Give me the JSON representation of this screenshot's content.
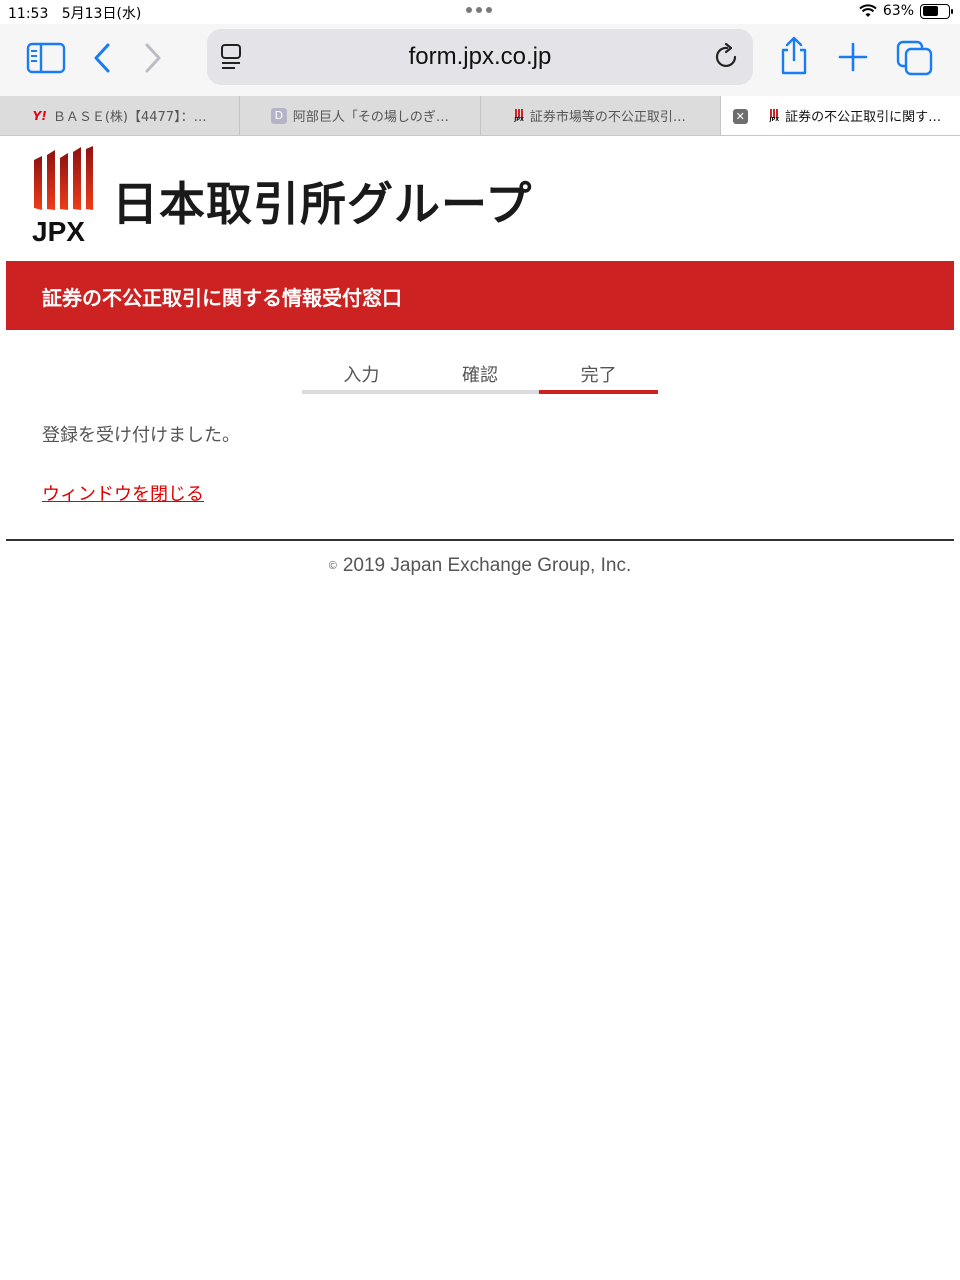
{
  "status_bar": {
    "time": "11:53",
    "date": "5月13日(水)",
    "battery_percent": "63%",
    "battery_level": 0.63
  },
  "toolbar": {
    "url": "form.jpx.co.jp",
    "accent_color": "#1a7cf5"
  },
  "tabs": [
    {
      "title": "ＢＡＳＥ(株)【4477】：…",
      "favicon": "yahoo-favicon"
    },
    {
      "title": "阿部巨人「その場しのぎ…",
      "favicon": "d-favicon"
    },
    {
      "title": "証券市場等の不公正取引…",
      "favicon": "jpx-favicon"
    },
    {
      "title": "証券の不公正取引に関す…",
      "favicon": "jpx-favicon"
    }
  ],
  "page": {
    "logo_text": "日本取引所グループ",
    "logo_abbr": "JPX",
    "banner_title": "証券の不公正取引に関する情報受付窓口",
    "steps": [
      "入力",
      "確認",
      "完了"
    ],
    "current_step": 3,
    "message": "登録を受け付けました。",
    "close_link": "ウィンドウを閉じる",
    "footer_symbol": "©",
    "footer": "2019 Japan Exchange Group, Inc.",
    "brand_color": "#cc2222"
  }
}
